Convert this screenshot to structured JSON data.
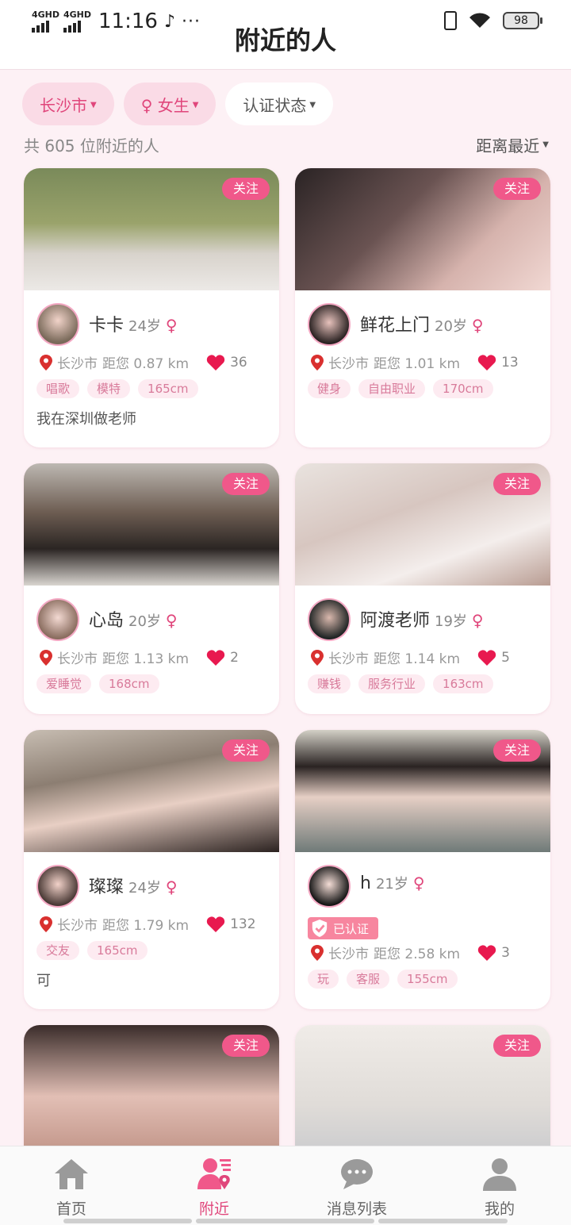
{
  "status": {
    "net1": "4GHD",
    "net2": "4GHD",
    "time": "11:16",
    "more": "···",
    "battery": "98"
  },
  "header": {
    "title": "附近的人"
  },
  "filters": {
    "city": "长沙市",
    "gender": "♀ 女生",
    "verify": "认证状态"
  },
  "summary": {
    "count_text": "共 605 位附近的人",
    "sort_label": "距离最近"
  },
  "labels": {
    "follow": "关注",
    "verified": "已认证"
  },
  "cards": [
    {
      "name": "卡卡",
      "age": "24岁",
      "gender": "♀",
      "city": "长沙市",
      "distance": "距您 0.87 km",
      "likes": "36",
      "tags": [
        "唱歌",
        "模特",
        "165cm"
      ],
      "bio": "我在深圳做老师",
      "verified": false
    },
    {
      "name": "鲜花上门",
      "age": "20岁",
      "gender": "♀",
      "city": "长沙市",
      "distance": "距您 1.01 km",
      "likes": "13",
      "tags": [
        "健身",
        "自由职业",
        "170cm"
      ],
      "bio": "",
      "verified": false
    },
    {
      "name": "心岛",
      "age": "20岁",
      "gender": "♀",
      "city": "长沙市",
      "distance": "距您 1.13 km",
      "likes": "2",
      "tags": [
        "爱睡觉",
        "168cm"
      ],
      "bio": "",
      "verified": false
    },
    {
      "name": "阿渡老师",
      "age": "19岁",
      "gender": "♀",
      "city": "长沙市",
      "distance": "距您 1.14 km",
      "likes": "5",
      "tags": [
        "赚钱",
        "服务行业",
        "163cm"
      ],
      "bio": "",
      "verified": false
    },
    {
      "name": "璨璨",
      "age": "24岁",
      "gender": "♀",
      "city": "长沙市",
      "distance": "距您 1.79 km",
      "likes": "132",
      "tags": [
        "交友",
        "165cm"
      ],
      "bio": "可",
      "verified": false
    },
    {
      "name": "h",
      "age": "21岁",
      "gender": "♀",
      "city": "长沙市",
      "distance": "距您 2.58 km",
      "likes": "3",
      "tags": [
        "玩",
        "客服",
        "155cm"
      ],
      "bio": "",
      "verified": true
    },
    {
      "partial": true
    },
    {
      "partial": true
    }
  ],
  "tabs": [
    {
      "label": "首页",
      "icon": "home-icon"
    },
    {
      "label": "附近",
      "icon": "nearby-icon"
    },
    {
      "label": "消息列表",
      "icon": "message-icon"
    },
    {
      "label": "我的",
      "icon": "profile-icon"
    }
  ],
  "colors": {
    "accent": "#e0467b",
    "follow_bg": "#f0588a",
    "page_bg": "#fdf1f5",
    "heart": "#e8194f",
    "pin": "#d9302f"
  }
}
